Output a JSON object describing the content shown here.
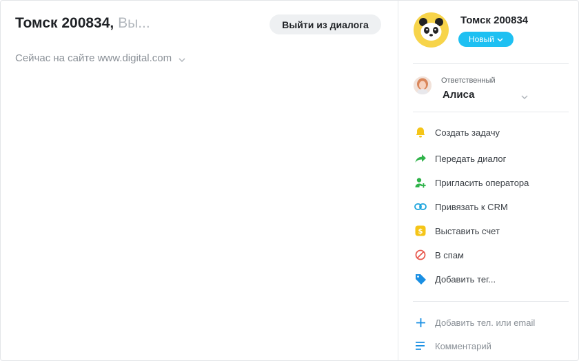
{
  "dialog": {
    "title": "Томск 200834,",
    "title_suffix": "Вы...",
    "exit_button_label": "Выйти из диалога",
    "online_status": "Сейчас на сайте www.digital.com"
  },
  "client": {
    "name": "Томск 200834",
    "status_label": "Новый",
    "status_color": "#1ec0f2"
  },
  "responsible": {
    "label": "Ответственный",
    "name": "Алиса"
  },
  "actions": [
    {
      "label": "Создать задачу",
      "icon": "bell-icon",
      "color": "#f5c518"
    },
    {
      "label": "Передать диалог",
      "icon": "forward-arrow-icon",
      "color": "#2fb34a"
    },
    {
      "label": "Пригласить оператора",
      "icon": "add-user-icon",
      "color": "#2fb34a"
    },
    {
      "label": "Привязать к CRM",
      "icon": "link-icon",
      "color": "#1aa3dc"
    },
    {
      "label": "Выставить счет",
      "icon": "dollar-icon",
      "color": "#f5c518"
    },
    {
      "label": "В спам",
      "icon": "ban-icon",
      "color": "#e85a4f"
    },
    {
      "label": "Добавить тег...",
      "icon": "tag-icon",
      "color": "#1a8fe3"
    }
  ],
  "extras": [
    {
      "label": "Добавить тел. или email",
      "icon": "plus-icon",
      "color": "#1a8fe3"
    },
    {
      "label": "Комментарий",
      "icon": "comment-lines-icon",
      "color": "#1a8fe3"
    }
  ]
}
